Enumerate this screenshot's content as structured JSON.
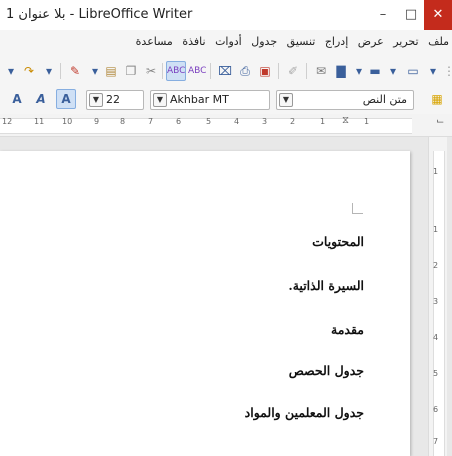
{
  "window": {
    "title": "بلا عنوان 1 - LibreOffice Writer",
    "minimize_glyph": "–",
    "maximize_glyph": "□",
    "close_glyph": "✕"
  },
  "menubar": {
    "items": [
      "ملف",
      "تحرير",
      "عرض",
      "إدراج",
      "تنسيق",
      "جدول",
      "أدوات",
      "نافذة",
      "مساعدة"
    ]
  },
  "toolbar_formatting": {
    "paragraph_style": "متن النص",
    "font_name": "Akhbar MT",
    "font_size": "22"
  },
  "ruler": {
    "ticks": [
      "12",
      "11",
      "10",
      "9",
      "8",
      "7",
      "6",
      "5",
      "4",
      "3",
      "2",
      "1",
      "1"
    ]
  },
  "vertical_ruler": {
    "ticks": [
      "1",
      "1",
      "2",
      "3",
      "4",
      "5",
      "6",
      "7",
      "8"
    ]
  },
  "document": {
    "paragraphs": [
      "المحتويات",
      "السيرة الذاتية.",
      "مقدمة",
      "جدول الحصص",
      "جدول المعلمين والمواد"
    ]
  }
}
